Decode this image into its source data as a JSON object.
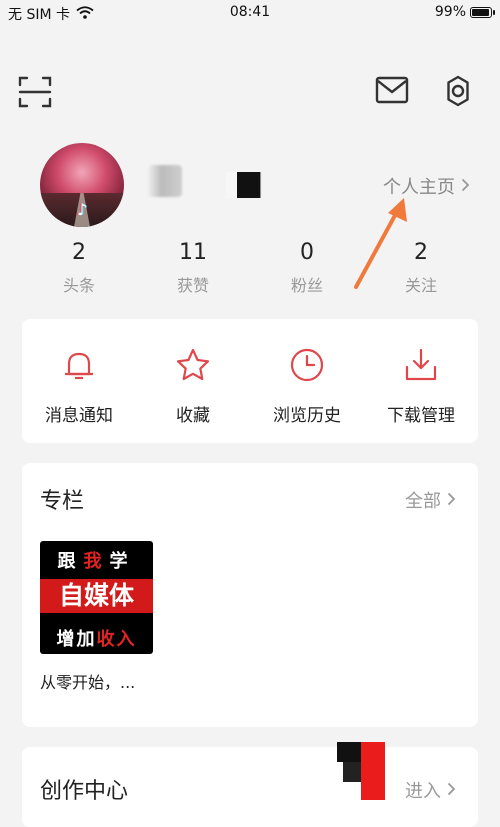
{
  "status_bar": {
    "carrier": "无 SIM 卡",
    "time": "08:41",
    "battery": "99%",
    "battery_level": 0.99
  },
  "top_bar": {
    "scan_icon": "scan-icon",
    "mail_icon": "mail-icon",
    "settings_icon": "gear-icon"
  },
  "profile": {
    "homepage_label": "个人主页"
  },
  "stats": [
    {
      "value": "2",
      "label": "头条"
    },
    {
      "value": "11",
      "label": "获赞"
    },
    {
      "value": "0",
      "label": "粉丝"
    },
    {
      "value": "2",
      "label": "关注"
    }
  ],
  "quick_actions": [
    {
      "label": "消息通知",
      "icon": "bell-icon"
    },
    {
      "label": "收藏",
      "icon": "star-icon"
    },
    {
      "label": "浏览历史",
      "icon": "clock-icon"
    },
    {
      "label": "下载管理",
      "icon": "download-icon"
    }
  ],
  "column_section": {
    "title": "专栏",
    "more_label": "全部",
    "item": {
      "title": "从零开始，...",
      "cover_lines": [
        "跟我学",
        "自媒体",
        "增加收入"
      ]
    }
  },
  "creator_section": {
    "title": "创作中心",
    "more_label": "进入"
  },
  "colors": {
    "accent": "#e0474c",
    "annotation_arrow": "#f07a3c"
  }
}
